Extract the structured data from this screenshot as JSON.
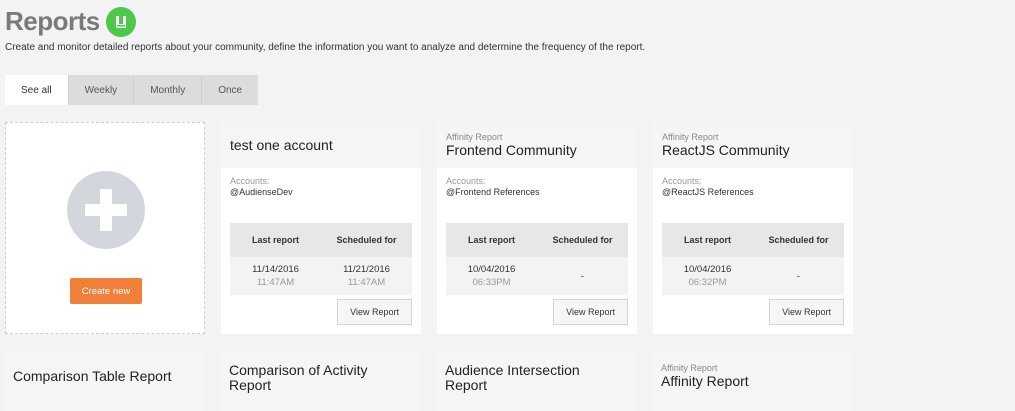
{
  "header": {
    "title": "Reports",
    "subtitle": "Create and monitor detailed reports about your community, define the information you want to analyze and determine the frequency of the report.",
    "icon": "report-book-icon",
    "icon_color": "#4cc94a"
  },
  "tabs": [
    {
      "label": "See all",
      "active": true
    },
    {
      "label": "Weekly",
      "active": false
    },
    {
      "label": "Monthly",
      "active": false
    },
    {
      "label": "Once",
      "active": false
    }
  ],
  "create": {
    "button_label": "Create new",
    "icon": "plus-icon",
    "button_color": "#f07f3a"
  },
  "table_headers": {
    "last": "Last report",
    "scheduled": "Scheduled for"
  },
  "view_label": "View Report",
  "cards": [
    {
      "type": "",
      "name": "test one account",
      "accounts_label": "Accounts:",
      "account": "@AudienseDev",
      "last_date": "11/14/2016",
      "last_time": "11:47AM",
      "sched_date": "11/21/2016",
      "sched_time": "11:47AM"
    },
    {
      "type": "Affinity Report",
      "name": "Frontend Community",
      "accounts_label": "Accounts:",
      "account": "@Frontend References",
      "last_date": "10/04/2016",
      "last_time": "06:33PM",
      "sched": "-"
    },
    {
      "type": "Affinity Report",
      "name": "ReactJS Community",
      "accounts_label": "Accounts:",
      "account": "@ReactJS References",
      "last_date": "10/04/2016",
      "last_time": "06:32PM",
      "sched": "-"
    }
  ],
  "bottom_cards": [
    {
      "type": "",
      "name": "Comparison Table Report"
    },
    {
      "type": "",
      "name": "Comparison of Activity Report"
    },
    {
      "type": "",
      "name": "Audience Intersection Report"
    },
    {
      "type": "Affinity Report",
      "name": "Affinity Report"
    }
  ]
}
